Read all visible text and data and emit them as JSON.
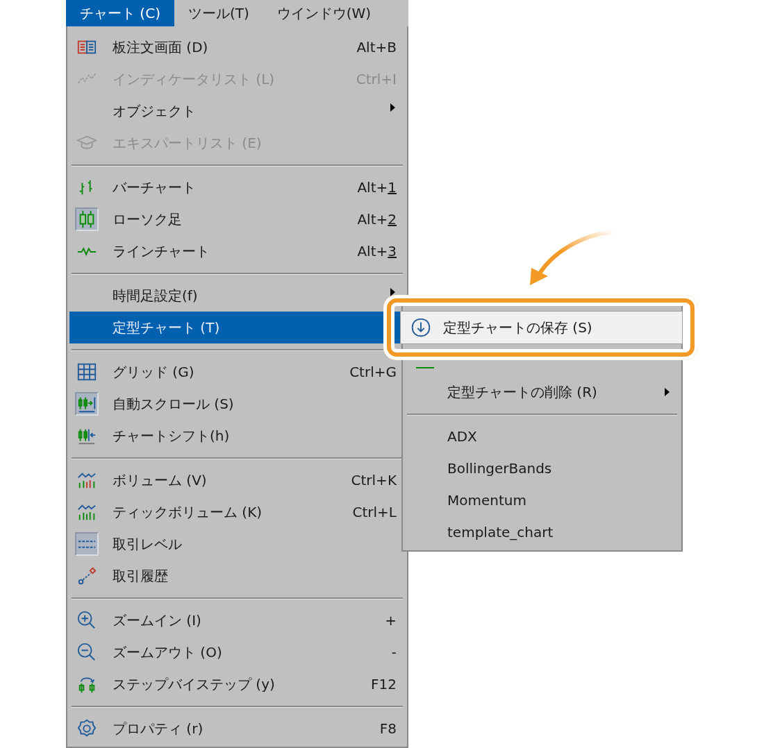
{
  "menu_bar": [
    {
      "label": "チャート (C)",
      "selected": true
    },
    {
      "label": "ツール(T)",
      "selected": false
    },
    {
      "label": "ウインドウ(W)",
      "selected": false
    }
  ],
  "menu": {
    "groups": [
      [
        {
          "label": "板注文画面 (D)",
          "shortcut": "Alt+B",
          "underline_last": false,
          "disabled": false,
          "checked": false,
          "selected": false,
          "has_submenu": false
        },
        {
          "label": "インディケータリスト (L)",
          "shortcut": "Ctrl+I",
          "underline_last": false,
          "disabled": true,
          "checked": false,
          "selected": false,
          "has_submenu": false
        },
        {
          "label": "オブジェクト",
          "disabled": false,
          "checked": false,
          "selected": false,
          "has_submenu": true
        },
        {
          "label": "エキスパートリスト (E)",
          "disabled": true,
          "checked": false,
          "selected": false,
          "has_submenu": false
        }
      ],
      [
        {
          "label": "バーチャート",
          "shortcut": "Alt+1",
          "underline_last": true,
          "disabled": false,
          "checked": false,
          "selected": false,
          "has_submenu": false
        },
        {
          "label": "ローソク足",
          "shortcut": "Alt+2",
          "underline_last": true,
          "disabled": false,
          "checked": true,
          "selected": false,
          "has_submenu": false
        },
        {
          "label": "ラインチャート",
          "shortcut": "Alt+3",
          "underline_last": true,
          "disabled": false,
          "checked": false,
          "selected": false,
          "has_submenu": false
        }
      ],
      [
        {
          "label": "時間足設定(f)",
          "disabled": false,
          "checked": false,
          "selected": false,
          "has_submenu": true
        },
        {
          "label": "定型チャート (T)",
          "disabled": false,
          "checked": false,
          "selected": true,
          "has_submenu": false
        }
      ],
      [
        {
          "label": "グリッド (G)",
          "shortcut": "Ctrl+G",
          "underline_last": false,
          "disabled": false,
          "checked": false,
          "selected": false,
          "has_submenu": false
        },
        {
          "label": "自動スクロール (S)",
          "disabled": false,
          "checked": true,
          "selected": false,
          "has_submenu": false
        },
        {
          "label": "チャートシフト(h)",
          "disabled": false,
          "checked": false,
          "selected": false,
          "has_submenu": false
        }
      ],
      [
        {
          "label": "ボリューム (V)",
          "shortcut": "Ctrl+K",
          "underline_last": false,
          "disabled": false,
          "checked": false,
          "selected": false,
          "has_submenu": false
        },
        {
          "label": "ティックボリューム (K)",
          "shortcut": "Ctrl+L",
          "underline_last": false,
          "disabled": false,
          "checked": false,
          "selected": false,
          "has_submenu": false
        },
        {
          "label": "取引レベル",
          "disabled": false,
          "checked": true,
          "selected": false,
          "has_submenu": false
        },
        {
          "label": "取引履歴",
          "disabled": false,
          "checked": false,
          "selected": false,
          "has_submenu": false
        }
      ],
      [
        {
          "label": "ズームイン (I)",
          "shortcut": "+",
          "underline_last": false,
          "disabled": false,
          "checked": false,
          "selected": false,
          "has_submenu": false
        },
        {
          "label": "ズームアウト (O)",
          "shortcut": "-",
          "underline_last": false,
          "disabled": false,
          "checked": false,
          "selected": false,
          "has_submenu": false
        },
        {
          "label": "ステップバイステップ (y)",
          "shortcut": "F12",
          "underline_last": false,
          "disabled": false,
          "checked": false,
          "selected": false,
          "has_submenu": false
        }
      ],
      [
        {
          "label": "プロパティ (r)",
          "shortcut": "F8",
          "underline_last": false,
          "disabled": false,
          "checked": false,
          "selected": false,
          "has_submenu": false
        }
      ]
    ]
  },
  "submenu": {
    "groups": [
      [
        {
          "label": "定型チャートの保存 (S)",
          "selected": true,
          "has_submenu": false
        },
        {
          "selected": false,
          "has_submenu": false
        },
        {
          "label": "定型チャートの削除 (R)",
          "selected": false,
          "has_submenu": true
        }
      ],
      [
        {
          "label": "ADX",
          "selected": false,
          "has_submenu": false
        },
        {
          "label": "BollingerBands",
          "selected": false,
          "has_submenu": false
        },
        {
          "label": "Momentum",
          "selected": false,
          "has_submenu": false
        },
        {
          "label": "template_chart",
          "selected": false,
          "has_submenu": false
        }
      ]
    ]
  }
}
